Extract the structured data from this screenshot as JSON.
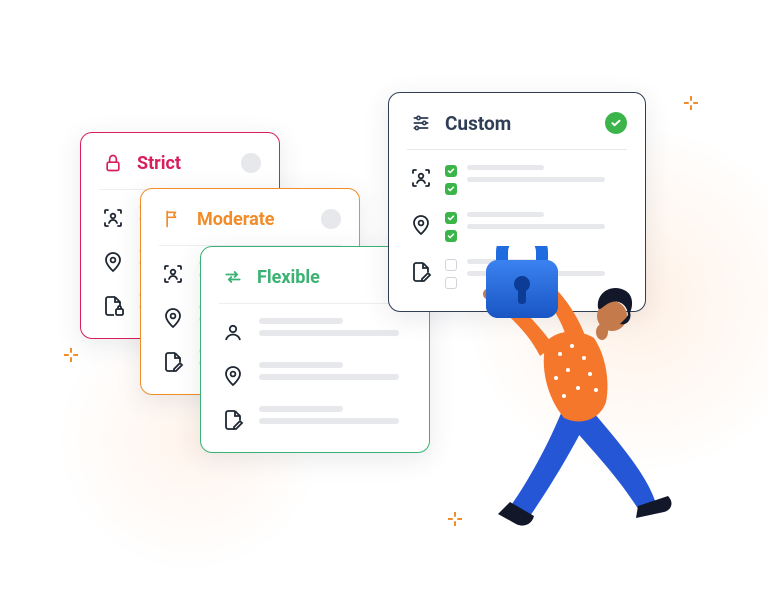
{
  "cards": {
    "strict": {
      "label": "Strict",
      "color": "#d81e5b"
    },
    "moderate": {
      "label": "Moderate",
      "color": "#f28c28"
    },
    "flexible": {
      "label": "Flexible",
      "color": "#3bb273"
    },
    "custom": {
      "label": "Custom",
      "color": "#2f3e55",
      "selected": true,
      "options": [
        {
          "checks": [
            true,
            true
          ]
        },
        {
          "checks": [
            true,
            true
          ]
        },
        {
          "checks": [
            false,
            false
          ]
        }
      ]
    }
  },
  "icons": {
    "lock": "lock-icon",
    "flag": "flag-icon",
    "swap": "swap-icon",
    "sliders": "sliders-icon",
    "face": "face-scan-icon",
    "pin": "location-pin-icon",
    "doc": "document-edit-icon",
    "user": "user-icon"
  }
}
